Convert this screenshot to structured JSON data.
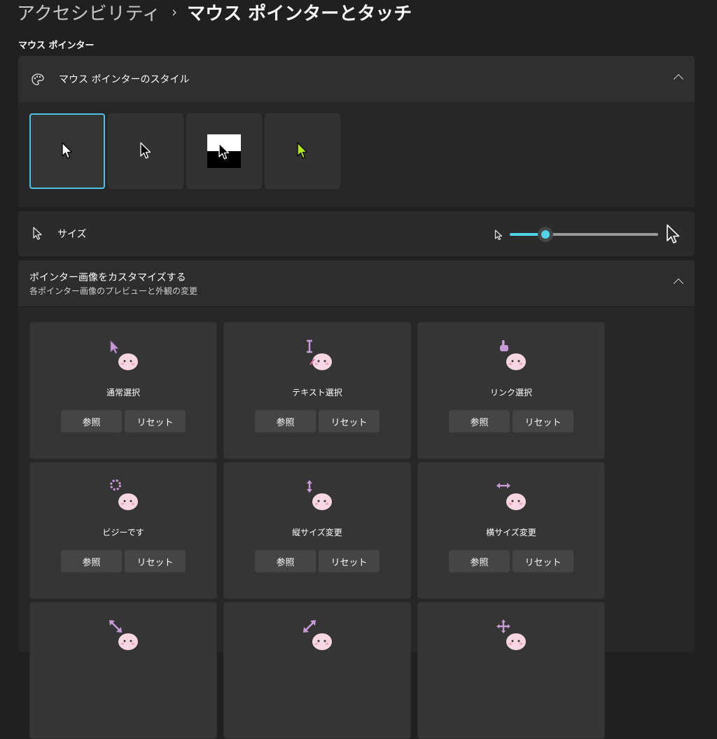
{
  "breadcrumb": {
    "parent": "アクセシビリティ",
    "separator": "›",
    "current": "マウス ポインターとタッチ"
  },
  "section": {
    "title": "マウス ポインター"
  },
  "pointer_style": {
    "label": "マウス ポインターのスタイル",
    "icon": "palette-icon",
    "options": [
      {
        "name": "white",
        "selected": true
      },
      {
        "name": "black",
        "selected": false
      },
      {
        "name": "inverted",
        "selected": false
      },
      {
        "name": "custom",
        "selected": false
      }
    ],
    "custom_color": "#b4e61e",
    "selection_color": "#4cc2e6"
  },
  "size": {
    "label": "サイズ",
    "slider_value": 0.24,
    "accent_color": "#4fd4ea"
  },
  "customize": {
    "title": "ポインター画像をカスタマイズする",
    "subtitle": "各ポインター画像のプレビューと外観の変更",
    "browse_label": "参照",
    "reset_label": "リセット",
    "tiles": [
      {
        "label": "通常選択",
        "icon": "arrow-cursor-icon"
      },
      {
        "label": "テキスト選択",
        "icon": "text-cursor-icon"
      },
      {
        "label": "リンク選択",
        "icon": "hand-cursor-icon"
      },
      {
        "label": "ビジーです",
        "icon": "busy-cursor-icon"
      },
      {
        "label": "縦サイズ変更",
        "icon": "vertical-resize-icon"
      },
      {
        "label": "横サイズ変更",
        "icon": "horizontal-resize-icon"
      },
      {
        "label": "",
        "icon": "diagonal-resize-icon"
      },
      {
        "label": "",
        "icon": "diagonal-resize-alt-icon"
      },
      {
        "label": "",
        "icon": "move-cursor-icon"
      }
    ]
  }
}
